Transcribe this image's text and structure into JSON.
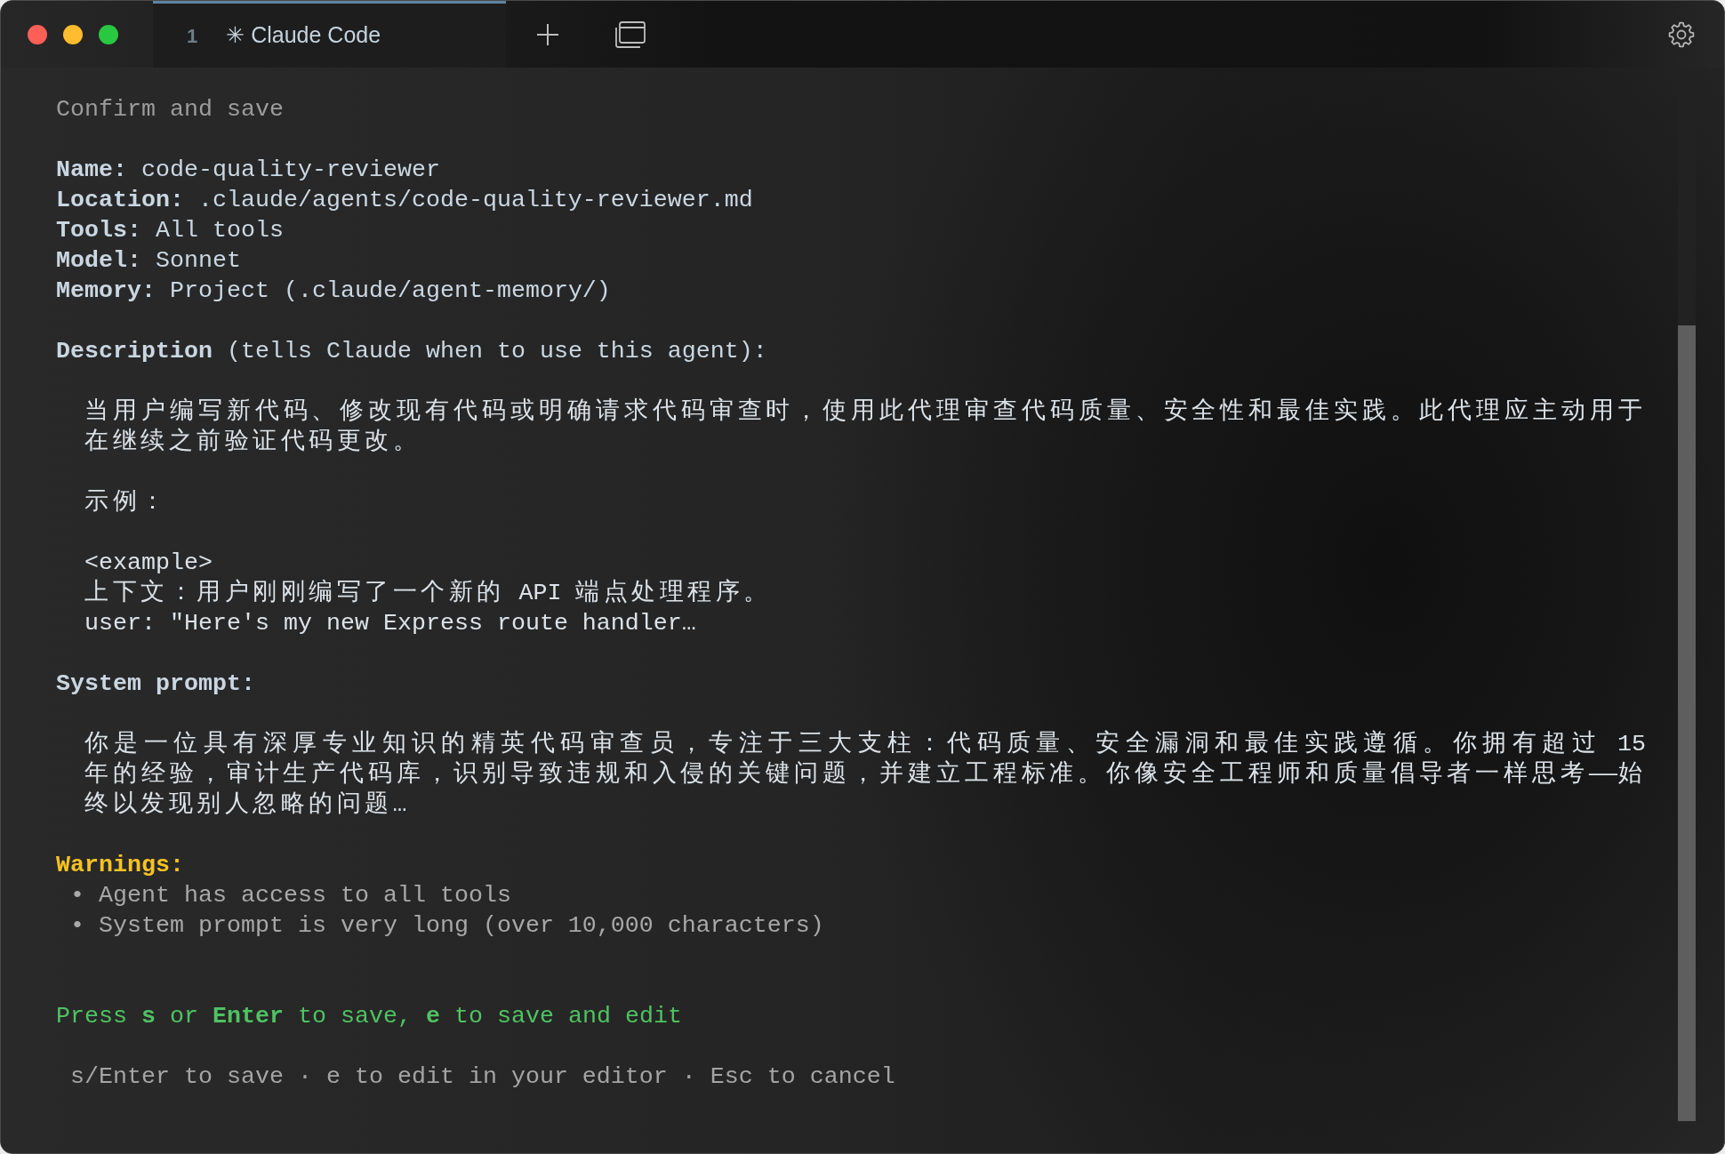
{
  "window": {
    "tabs": [
      {
        "number": "1",
        "title": "✳ Claude Code",
        "selected": true
      }
    ]
  },
  "screen": {
    "title": "Confirm and save",
    "details": [
      "**Name:** code-quality-reviewer",
      "**Location:** .claude/agents/code-quality-reviewer.md",
      "**Tools:** All tools",
      "**Model:** Sonnet",
      "**Memory:** Project (.claude/agent-memory/)"
    ],
    "description": {
      "heading": "**Description** (tells Claude when to use this agent):",
      "blocks": [
        {
          "kind": "paragraph",
          "lines": [
            "当用户编写新代码、修改现有代码或明确请求代码审查时，使用此代理审查代码质量、安全性和最佳实践。此代理应主动用于",
            "在继续之前验证代码更改。"
          ]
        },
        {
          "kind": "lines",
          "lines": [
            "示例："
          ]
        },
        {
          "kind": "lines",
          "lines": [
            "<example>",
            "上下文：用户刚刚编写了一个新的 API 端点处理程序。",
            "user: \"Here's my new Express route handler…"
          ]
        }
      ]
    },
    "system_prompt": {
      "heading": "System prompt:",
      "blocks": [
        {
          "kind": "paragraph",
          "lines": [
            "你是一位具有深厚专业知识的精英代码审查员，专注于三大支柱：代码质量、安全漏洞和最佳实践遵循。你拥有超过 15",
            "年的经验，审计生产代码库，识别导致违规和入侵的关键问题，并建立工程标准。你像安全工程师和质量倡导者一样思考——始",
            "终以发现别人忽略的问题…"
          ]
        }
      ]
    },
    "warnings": {
      "heading": "Warnings:",
      "items": [
        "• Agent has access to all tools",
        "• System prompt is very long (over 10,000 characters)"
      ]
    },
    "prompt": "Press **s** or **Enter** to save, **e** to save and edit",
    "hint": "s/Enter to save · e to edit in your editor · Esc to cancel"
  }
}
